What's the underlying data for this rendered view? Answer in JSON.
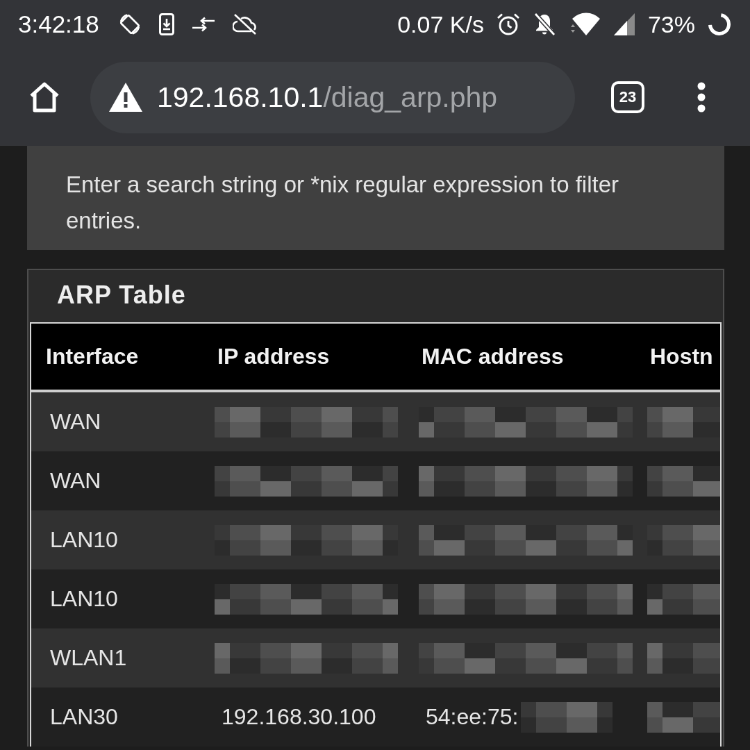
{
  "status_bar": {
    "time": "3:42:18",
    "network_speed": "0.07 K/s",
    "battery": "73%"
  },
  "browser_toolbar": {
    "url_host": "192.168.10.1",
    "url_path": "/diag_arp.php",
    "tab_count": "23"
  },
  "filter_hint": "Enter a search string or *nix regular expression to filter entries.",
  "arp_table": {
    "title": "ARP Table",
    "columns": [
      "Interface",
      "IP address",
      "MAC address",
      "Hostn"
    ],
    "rows": [
      {
        "cells": [
          {
            "text": "WAN",
            "redacted": false
          },
          {
            "redacted": true
          },
          {
            "redacted": true
          },
          {
            "redacted": true
          }
        ]
      },
      {
        "cells": [
          {
            "text": "WAN",
            "redacted": false
          },
          {
            "redacted": true
          },
          {
            "redacted": true
          },
          {
            "redacted": true
          }
        ]
      },
      {
        "cells": [
          {
            "text": "LAN10",
            "redacted": false
          },
          {
            "redacted": true
          },
          {
            "redacted": true
          },
          {
            "redacted": true
          }
        ]
      },
      {
        "cells": [
          {
            "text": "LAN10",
            "redacted": false
          },
          {
            "redacted": true
          },
          {
            "redacted": true
          },
          {
            "redacted": true
          }
        ]
      },
      {
        "cells": [
          {
            "text": "WLAN1",
            "redacted": false
          },
          {
            "redacted": true
          },
          {
            "redacted": true
          },
          {
            "redacted": true
          }
        ]
      },
      {
        "cells": [
          {
            "text": "LAN30",
            "redacted": false
          },
          {
            "text": "192.168.30.100",
            "redacted": false
          },
          {
            "text": "54:ee:75:",
            "redacted": true
          },
          {
            "redacted": true
          }
        ]
      }
    ]
  }
}
